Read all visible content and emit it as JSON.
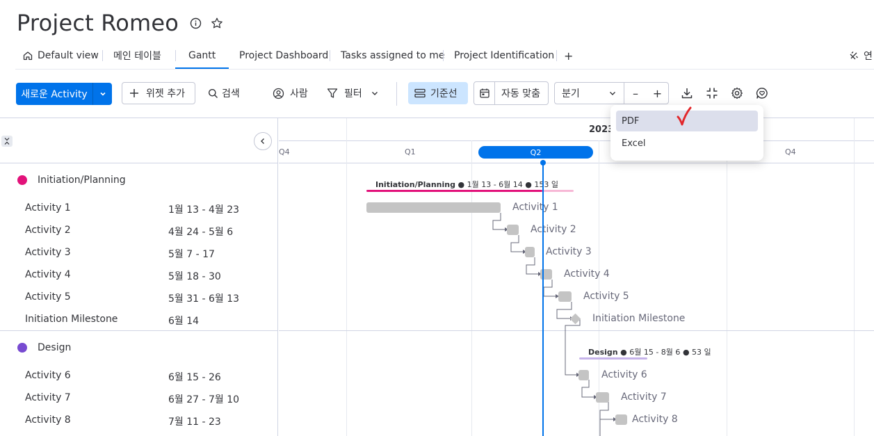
{
  "board": {
    "title": "Project Romeo",
    "info_icon": "info-icon",
    "star_icon": "star-icon"
  },
  "tabs": [
    {
      "label": "Default view",
      "icon": "home-icon"
    },
    {
      "label": "메인 테이블"
    },
    {
      "label": "Gantt",
      "active": true
    },
    {
      "label": "Project Dashboard"
    },
    {
      "label": "Tasks assigned to me"
    },
    {
      "label": "Project Identification"
    },
    {
      "label": "+"
    }
  ],
  "tabs_right": {
    "label": "연"
  },
  "toolbar": {
    "new_item": "새로운 Activity",
    "add_widget": "위젯 추가",
    "search": "검색",
    "person": "사람",
    "filter": "필터",
    "baseline": "기준선",
    "auto_fit": "자동 맞춤",
    "zoom_level": "분기",
    "zoom_out": "–",
    "zoom_in": "+"
  },
  "export_menu": {
    "items": [
      "PDF",
      "Excel"
    ]
  },
  "timeline": {
    "year": "2023",
    "quarters": [
      "Q4",
      "Q1",
      "Q2",
      "Q4"
    ],
    "current_quarter": "Q2"
  },
  "groups": [
    {
      "name": "Initiation/Planning",
      "color": "#e2127a",
      "summary_name": "Initiation/Planning",
      "summary_range": "1월 13 - 6월 14",
      "summary_days": "153 일",
      "items": [
        {
          "name": "Activity 1",
          "date": "1월 13 - 4월 23"
        },
        {
          "name": "Activity 2",
          "date": "4월 24 - 5월 6"
        },
        {
          "name": "Activity 3",
          "date": "5월 7 - 17"
        },
        {
          "name": "Activity 4",
          "date": "5월 18 - 30"
        },
        {
          "name": "Activity 5",
          "date": "5월 31 - 6월 13"
        },
        {
          "name": "Initiation Milestone",
          "date": "6월 14"
        }
      ]
    },
    {
      "name": "Design",
      "color": "#784bd1",
      "summary_name": "Design",
      "summary_range": "6월 15 - 8월 6",
      "summary_days": "53 일",
      "items": [
        {
          "name": "Activity 6",
          "date": "6월 15 - 26"
        },
        {
          "name": "Activity 7",
          "date": "6월 27 - 7월 10"
        },
        {
          "name": "Activity 8",
          "date": "7월 11 - 23"
        }
      ]
    }
  ],
  "colors": {
    "primary": "#0073ea",
    "baseline_bg": "#cce5ff",
    "bar": "#c4c4c4",
    "check_mark": "#e2272b"
  }
}
